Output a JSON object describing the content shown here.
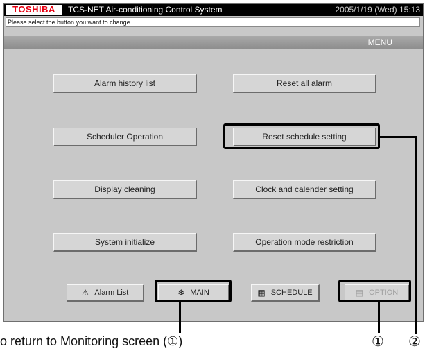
{
  "header": {
    "logo": "TOSHIBA",
    "title": "TCS-NET Air-conditioning Control System",
    "datetime": "2005/1/19 (Wed)  15:13"
  },
  "message": "Please select the button you want to change.",
  "section": "MENU",
  "menu": {
    "alarm_history": "Alarm history list",
    "reset_all_alarm": "Reset all alarm",
    "scheduler_operation": "Scheduler Operation",
    "reset_schedule": "Reset schedule setting",
    "display_cleaning": "Display cleaning",
    "clock_calendar": "Clock and calender setting",
    "system_initialize": "System initialize",
    "operation_mode": "Operation mode restriction"
  },
  "bottom": {
    "alarm_list": "Alarm List",
    "main": "MAIN",
    "schedule": "SCHEDULE",
    "option": "OPTION"
  },
  "annotation": {
    "caption": "o return to Monitoring screen (①)",
    "marker1": "①",
    "marker2": "②"
  },
  "colors": {
    "logo_red": "#e60012",
    "screen_bg": "#c8c8c8",
    "section_bar": "#8e8e8e"
  },
  "icons": {
    "alarm": "warning-triangle-icon",
    "main": "indoor-unit-icon",
    "schedule": "calendar-icon",
    "option": "option-icon"
  }
}
